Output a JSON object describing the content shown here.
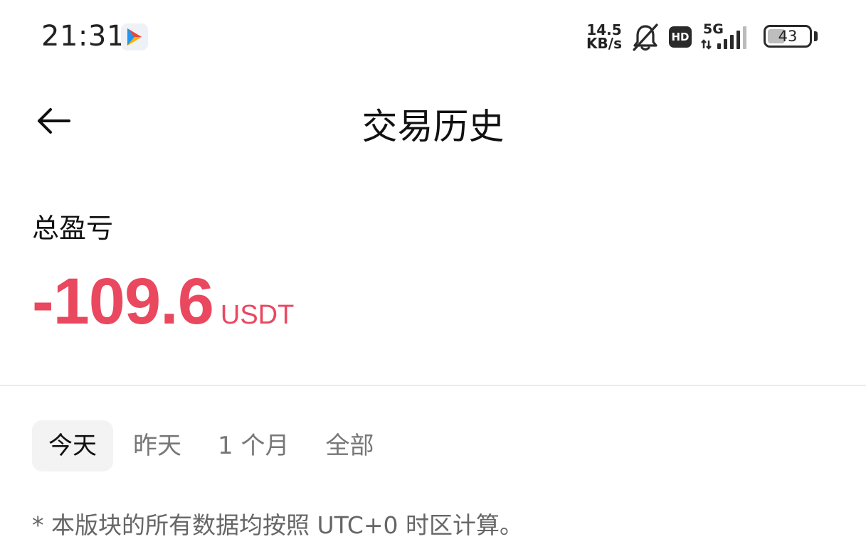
{
  "status_bar": {
    "time": "21:31",
    "net_speed_value": "14.5",
    "net_speed_unit": "KB/s",
    "hd_badge": "HD",
    "network_type": "5G",
    "battery_percent": "43",
    "battery_level": 0.43,
    "icons": [
      "app-play-icon",
      "bell-muted-icon",
      "hd-icon",
      "signal-icon",
      "battery-icon"
    ]
  },
  "header": {
    "back_icon": "arrow-left-icon",
    "title": "交易历史"
  },
  "pnl": {
    "label": "总盈亏",
    "value": "-109.6",
    "unit": "USDT",
    "color": "#e9485f"
  },
  "tabs": [
    {
      "label": "今天",
      "active": true
    },
    {
      "label": "昨天",
      "active": false
    },
    {
      "label": "1 个月",
      "active": false
    },
    {
      "label": "全部",
      "active": false
    }
  ],
  "footnote": "* 本版块的所有数据均按照 UTC+0 时区计算。"
}
